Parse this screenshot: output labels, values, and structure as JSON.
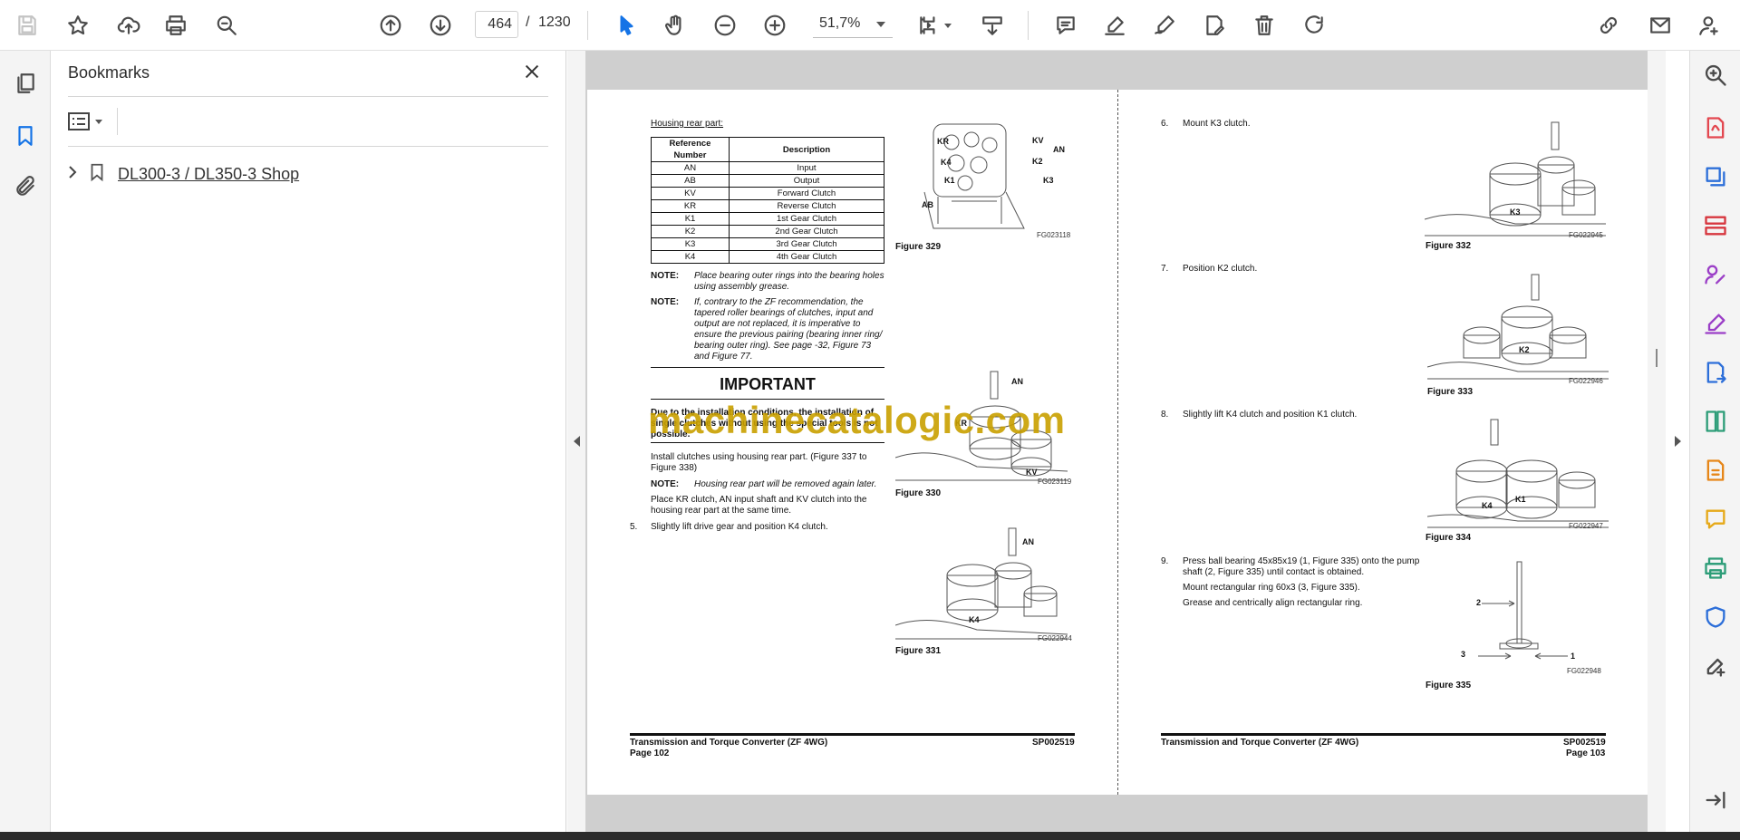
{
  "toolbar": {
    "page_current": "464",
    "page_separator": "/",
    "page_total": "1230",
    "zoom": "51,7%"
  },
  "bookmarks": {
    "title": "Bookmarks",
    "items": [
      {
        "label": "DL300-3 / DL350-3 Shop"
      }
    ]
  },
  "watermark": "machinecatalogic.com",
  "left_page": {
    "heading": "Housing rear part:",
    "table": {
      "headers": [
        "Reference Number",
        "Description"
      ],
      "rows": [
        [
          "AN",
          "Input"
        ],
        [
          "AB",
          "Output"
        ],
        [
          "KV",
          "Forward Clutch"
        ],
        [
          "KR",
          "Reverse Clutch"
        ],
        [
          "K1",
          "1st Gear Clutch"
        ],
        [
          "K2",
          "2nd Gear Clutch"
        ],
        [
          "K3",
          "3rd Gear Clutch"
        ],
        [
          "K4",
          "4th Gear Clutch"
        ]
      ]
    },
    "note1_label": "NOTE:",
    "note1_l1": "Place bearing outer rings into the bearing holes",
    "note1_l2": "using assembly grease.",
    "note2_label": "NOTE:",
    "note2_l1": "If, contrary to the ZF recommendation, the",
    "note2_l2": "tapered roller bearings of clutches, input and",
    "note2_l3": "output are not replaced, it is imperative to",
    "note2_l4": "ensure the previous pairing (bearing inner ring/",
    "note2_l5": "bearing outer ring). See page -32, Figure 73",
    "note2_l6": "and Figure 77.",
    "important": "IMPORTANT",
    "imp_l1": "Due to the installation conditions, the installation of",
    "imp_l2": "single clutches without using the special tools is not",
    "imp_l3": "possible.",
    "install_l1": "Install clutches using housing rear part. (Figure 337 to",
    "install_l2": "Figure 338)",
    "note3_label": "NOTE:",
    "note3_text": "Housing rear part will be removed again later.",
    "place_l1": "Place KR clutch, AN input shaft and KV clutch into the",
    "place_l2": "housing rear part at the same time.",
    "step5_num": "5.",
    "step5_text": "Slightly lift drive gear and position K4 clutch.",
    "fig329": {
      "caption": "Figure 329",
      "code": "FG023118",
      "labels": [
        "KR",
        "KV",
        "AN",
        "K4",
        "K2",
        "K1",
        "K3",
        "AB"
      ]
    },
    "fig330": {
      "caption": "Figure 330",
      "code": "FG023119",
      "labels": [
        "AN",
        "KV",
        "KR"
      ]
    },
    "fig331": {
      "caption": "Figure 331",
      "code": "FG022944",
      "labels": [
        "AN",
        "K4"
      ]
    },
    "footer_title": "Transmission and Torque Converter (ZF 4WG)",
    "footer_page": "Page 102",
    "footer_code": "SP002519"
  },
  "right_page": {
    "step6_num": "6.",
    "step6_text": "Mount K3 clutch.",
    "fig332": {
      "caption": "Figure 332",
      "code": "FG022945",
      "label": "K3"
    },
    "step7_num": "7.",
    "step7_text": "Position K2 clutch.",
    "fig333": {
      "caption": "Figure 333",
      "code": "FG022946",
      "label": "K2"
    },
    "step8_num": "8.",
    "step8_text": "Slightly lift K4 clutch and position K1 clutch.",
    "fig334": {
      "caption": "Figure 334",
      "code": "FG022947",
      "labels": [
        "K4",
        "K1"
      ]
    },
    "step9_num": "9.",
    "step9_l1": "Press ball bearing 45x85x19 (1, Figure 335) onto the pump",
    "step9_l2": "shaft (2, Figure 335) until contact is obtained.",
    "step9_l3": "Mount rectangular ring 60x3 (3, Figure 335).",
    "step9_l4": "Grease and centrically align rectangular ring.",
    "fig335": {
      "caption": "Figure 335",
      "code": "FG022948",
      "labels": [
        "2",
        "3",
        "1"
      ]
    },
    "footer_title": "Transmission and Torque Converter (ZF 4WG)",
    "footer_page": "Page 103",
    "footer_code": "SP002519"
  }
}
